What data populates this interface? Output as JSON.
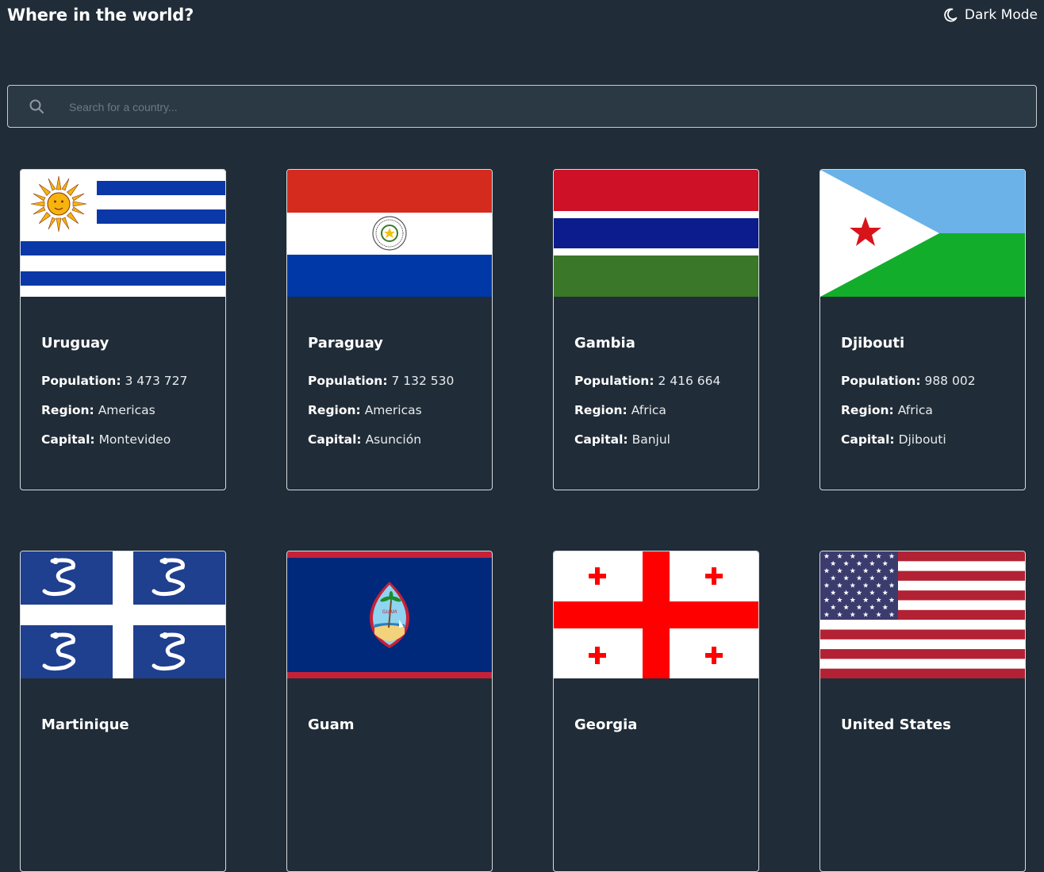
{
  "header": {
    "title": "Where in the world?",
    "mode_label": "Dark Mode",
    "mode_icon": "moon-icon"
  },
  "search": {
    "placeholder": "Search for a country...",
    "icon": "search-icon"
  },
  "labels": {
    "population": "Population:",
    "region": "Region:",
    "capital": "Capital:"
  },
  "countries": [
    {
      "name": "Uruguay",
      "population": "3 473 727",
      "region": "Americas",
      "capital": "Montevideo"
    },
    {
      "name": "Paraguay",
      "population": "7 132 530",
      "region": "Americas",
      "capital": "Asunción"
    },
    {
      "name": "Gambia",
      "population": "2 416 664",
      "region": "Africa",
      "capital": "Banjul"
    },
    {
      "name": "Djibouti",
      "population": "988 002",
      "region": "Africa",
      "capital": "Djibouti"
    },
    {
      "name": "Martinique"
    },
    {
      "name": "Guam"
    },
    {
      "name": "Georgia"
    },
    {
      "name": "United States"
    }
  ],
  "colors": {
    "background": "#202c37",
    "search_background": "#2b3945",
    "text": "#ffffff"
  }
}
